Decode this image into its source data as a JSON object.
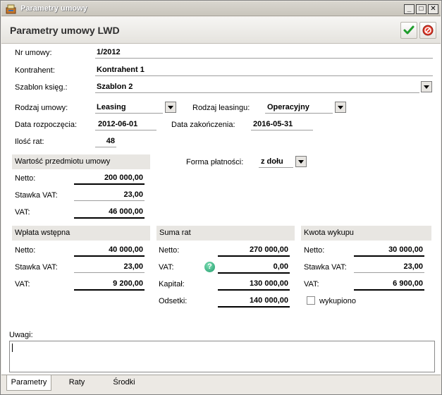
{
  "window": {
    "title": "Parametry umowy"
  },
  "header": {
    "title": "Parametry umowy LWD"
  },
  "fields": {
    "nr_umowy": {
      "label": "Nr umowy:",
      "value": "1/2012"
    },
    "kontrahent": {
      "label": "Kontrahent:",
      "value": "Kontrahent 1"
    },
    "szablon": {
      "label": "Szablon księg.:",
      "value": "Szablon 2"
    },
    "rodzaj_umowy": {
      "label": "Rodzaj umowy:",
      "value": "Leasing"
    },
    "rodzaj_leasingu": {
      "label": "Rodzaj leasingu:",
      "value": "Operacyjny"
    },
    "data_rozp": {
      "label": "Data rozpoczęcia:",
      "value": "2012-06-01"
    },
    "data_zak": {
      "label": "Data zakończenia:",
      "value": "2016-05-31"
    },
    "ilosc_rat": {
      "label": "Ilość rat:",
      "value": "48"
    },
    "forma_platnosci": {
      "label": "Forma płatności:",
      "value": "z dołu"
    }
  },
  "wartosc": {
    "title": "Wartość przedmiotu umowy",
    "netto_label": "Netto:",
    "netto": "200 000,00",
    "stawka_label": "Stawka VAT:",
    "stawka": "23,00",
    "vat_label": "VAT:",
    "vat": "46 000,00"
  },
  "wplata": {
    "title": "Wpłata wstępna",
    "netto_label": "Netto:",
    "netto": "40 000,00",
    "stawka_label": "Stawka VAT:",
    "stawka": "23,00",
    "vat_label": "VAT:",
    "vat": "9 200,00"
  },
  "suma": {
    "title": "Suma rat",
    "netto_label": "Netto:",
    "netto": "270 000,00",
    "vat_label": "VAT:",
    "vat": "0,00",
    "kapital_label": "Kapitał:",
    "kapital": "130 000,00",
    "odsetki_label": "Odsetki:",
    "odsetki": "140 000,00"
  },
  "wykup": {
    "title": "Kwota wykupu",
    "netto_label": "Netto:",
    "netto": "30 000,00",
    "stawka_label": "Stawka VAT:",
    "stawka": "23,00",
    "vat_label": "VAT:",
    "vat": "6 900,00",
    "checkbox_label": "wykupiono"
  },
  "uwagi": {
    "label": "Uwagi:",
    "value": ""
  },
  "tabs": [
    {
      "label": "Parametry"
    },
    {
      "label": "Raty"
    },
    {
      "label": "Środki"
    }
  ]
}
